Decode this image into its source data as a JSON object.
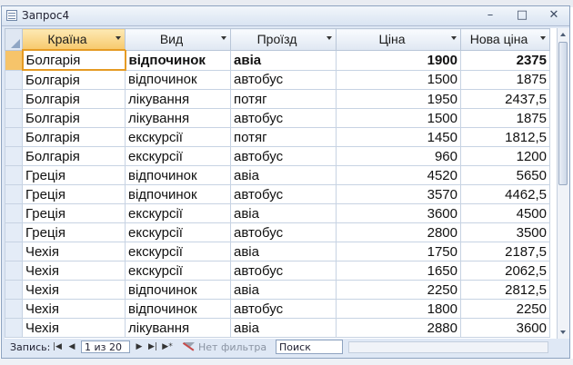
{
  "window": {
    "title": "Запрос4"
  },
  "columns": [
    "Країна",
    "Вид",
    "Проїзд",
    "Ціна",
    "Нова ціна"
  ],
  "rows": [
    [
      "Болгарія",
      "відпочинок",
      "авіа",
      "1900",
      "2375"
    ],
    [
      "Болгарія",
      "відпочинок",
      "автобус",
      "1500",
      "1875"
    ],
    [
      "Болгарія",
      "лікування",
      "потяг",
      "1950",
      "2437,5"
    ],
    [
      "Болгарія",
      "лікування",
      "автобус",
      "1500",
      "1875"
    ],
    [
      "Болгарія",
      "екскурсії",
      "потяг",
      "1450",
      "1812,5"
    ],
    [
      "Болгарія",
      "екскурсії",
      "автобус",
      "960",
      "1200"
    ],
    [
      "Греція",
      "відпочинок",
      "авіа",
      "4520",
      "5650"
    ],
    [
      "Греція",
      "відпочинок",
      "автобус",
      "3570",
      "4462,5"
    ],
    [
      "Греція",
      "екскурсії",
      "авіа",
      "3600",
      "4500"
    ],
    [
      "Греція",
      "екскурсії",
      "автобус",
      "2800",
      "3500"
    ],
    [
      "Чехія",
      "екскурсії",
      "авіа",
      "1750",
      "2187,5"
    ],
    [
      "Чехія",
      "екскурсії",
      "автобус",
      "1650",
      "2062,5"
    ],
    [
      "Чехія",
      "відпочинок",
      "авіа",
      "2250",
      "2812,5"
    ],
    [
      "Чехія",
      "відпочинок",
      "автобус",
      "1800",
      "2250"
    ],
    [
      "Чехія",
      "лікування",
      "авіа",
      "2880",
      "3600"
    ]
  ],
  "navigation": {
    "record_label": "Запись:",
    "position": "1 из 20",
    "filter_label": "Нет фильтра",
    "search_label": "Поиск"
  },
  "colors": {
    "selected_header": "#f7c96d",
    "active_cell_border": "#e59b24",
    "window_frame": "#8ea3c0"
  }
}
